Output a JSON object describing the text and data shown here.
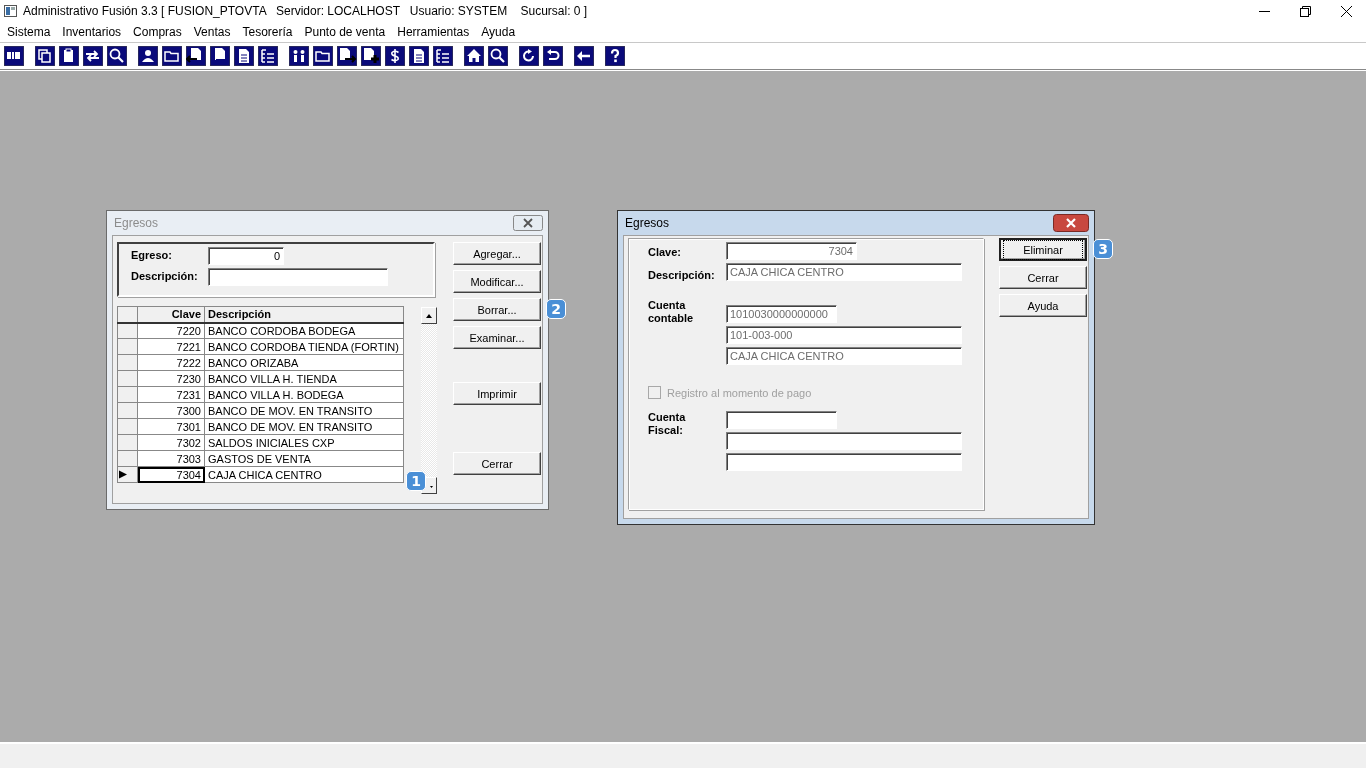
{
  "window": {
    "title": "Administrativo Fusión 3.3 [ FUSION_PTOVTA   Servidor: LOCALHOST   Usuario: SYSTEM    Sucursal: 0 ]"
  },
  "menu": [
    "Sistema",
    "Inventarios",
    "Compras",
    "Ventas",
    "Tesorería",
    "Punto de venta",
    "Herramientas",
    "Ayuda"
  ],
  "list_dialog": {
    "title": "Egresos",
    "active": false,
    "filter": [
      {
        "label": "Egreso:",
        "value": "0"
      },
      {
        "label": "Descripción:"
      }
    ],
    "table": {
      "columns": [
        "Clave",
        "Descripción"
      ],
      "callout": "1",
      "rows": [
        {
          "clave": "7220",
          "descripcion": "BANCO CORDOBA BODEGA",
          "selected": false
        },
        {
          "clave": "7221",
          "descripcion": "BANCO CORDOBA TIENDA (FORTIN)",
          "selected": false
        },
        {
          "clave": "7222",
          "descripcion": "BANCO ORIZABA",
          "selected": false
        },
        {
          "clave": "7230",
          "descripcion": "BANCO VILLA H. TIENDA",
          "selected": false
        },
        {
          "clave": "7231",
          "descripcion": "BANCO VILLA H. BODEGA",
          "selected": false
        },
        {
          "clave": "7300",
          "descripcion": "BANCO DE MOV. EN TRANSITO",
          "selected": false
        },
        {
          "clave": "7301",
          "descripcion": "BANCO DE MOV. EN TRANSITO",
          "selected": false
        },
        {
          "clave": "7302",
          "descripcion": "SALDOS INICIALES CXP",
          "selected": false
        },
        {
          "clave": "7303",
          "descripcion": "GASTOS DE VENTA",
          "selected": false
        },
        {
          "clave": "7304",
          "descripcion": "CAJA CHICA CENTRO",
          "selected": true
        }
      ]
    },
    "buttons": [
      {
        "label": "Agregar..."
      },
      {
        "label": "Modificar..."
      },
      {
        "label": "Borrar...",
        "callout": "2"
      },
      {
        "label": "Examinar..."
      },
      {
        "label": "Imprimir"
      },
      {
        "label": "Cerrar"
      }
    ]
  },
  "detail_dialog": {
    "title": "Egresos",
    "active": true,
    "clave": {
      "label": "Clave:",
      "value": "7304"
    },
    "descripcion": {
      "label": "Descripción:",
      "value": "CAJA CHICA CENTRO"
    },
    "cuenta_contable": {
      "label": "Cuenta contable",
      "values": [
        "1010030000000000",
        "101-003-000",
        "CAJA CHICA CENTRO"
      ]
    },
    "registro": {
      "label": "Registro al momento de pago",
      "checked": false,
      "disabled": true
    },
    "cuenta_fiscal": {
      "label": "Cuenta Fiscal:"
    },
    "buttons": [
      {
        "label": "Eliminar",
        "focused": true,
        "callout": "3"
      },
      {
        "label": "Cerrar",
        "focused": false
      },
      {
        "label": "Ayuda",
        "focused": false
      }
    ]
  }
}
